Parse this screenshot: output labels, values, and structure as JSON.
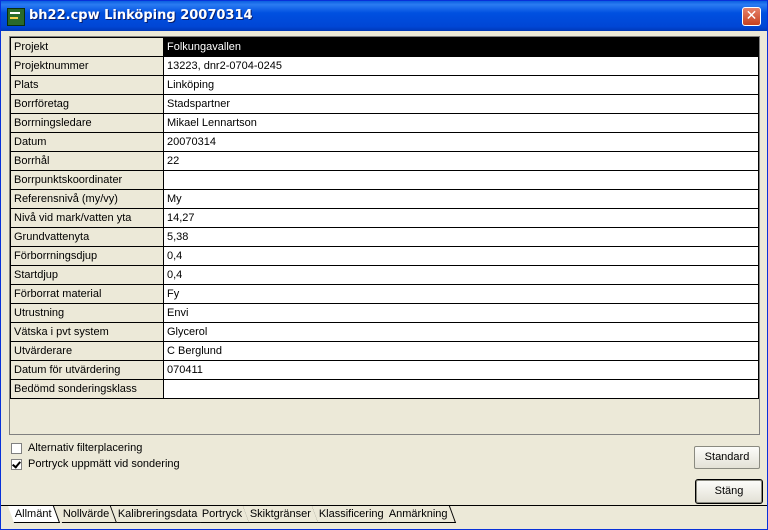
{
  "window": {
    "title": "bh22.cpw  Linköping 20070314",
    "close_label": "✕"
  },
  "properties": [
    {
      "label": "Projekt",
      "value": "Folkungavallen",
      "selected": true
    },
    {
      "label": "Projektnummer",
      "value": "13223, dnr2-0704-0245"
    },
    {
      "label": "Plats",
      "value": "Linköping"
    },
    {
      "label": "Borrföretag",
      "value": "Stadspartner"
    },
    {
      "label": "Borrningsledare",
      "value": "Mikael Lennartson"
    },
    {
      "label": "Datum",
      "value": "20070314"
    },
    {
      "label": "Borrhål",
      "value": "22"
    },
    {
      "label": "Borrpunktskoordinater",
      "value": ""
    },
    {
      "label": "Referensnivå (my/vy)",
      "value": "My"
    },
    {
      "label": "Nivå vid mark/vatten yta",
      "value": "14,27"
    },
    {
      "label": "Grundvattenyta",
      "value": "5,38"
    },
    {
      "label": "Förborrningsdjup",
      "value": "0,4"
    },
    {
      "label": "Startdjup",
      "value": "0,4"
    },
    {
      "label": "Förborrat material",
      "value": "Fy"
    },
    {
      "label": "Utrustning",
      "value": "Envi"
    },
    {
      "label": "Vätska i pvt system",
      "value": "Glycerol"
    },
    {
      "label": "Utvärderare",
      "value": "C Berglund"
    },
    {
      "label": "Datum för utvärdering",
      "value": "070411"
    },
    {
      "label": "Bedömd sonderingsklass",
      "value": ""
    }
  ],
  "options": {
    "alt_filter_label": "Alternativ filterplacering",
    "alt_filter_checked": false,
    "porttryck_label": "Portryck uppmätt vid sondering",
    "porttryck_checked": true
  },
  "buttons": {
    "standard_label": "Standard",
    "close_label": "Stäng"
  },
  "tabs": [
    {
      "label": "Allmänt",
      "active": true
    },
    {
      "label": "Nollvärde"
    },
    {
      "label": "Kalibreringsdata"
    },
    {
      "label": "Portryck"
    },
    {
      "label": "Skiktgränser"
    },
    {
      "label": "Klassificering"
    },
    {
      "label": "Anmärkning"
    }
  ]
}
